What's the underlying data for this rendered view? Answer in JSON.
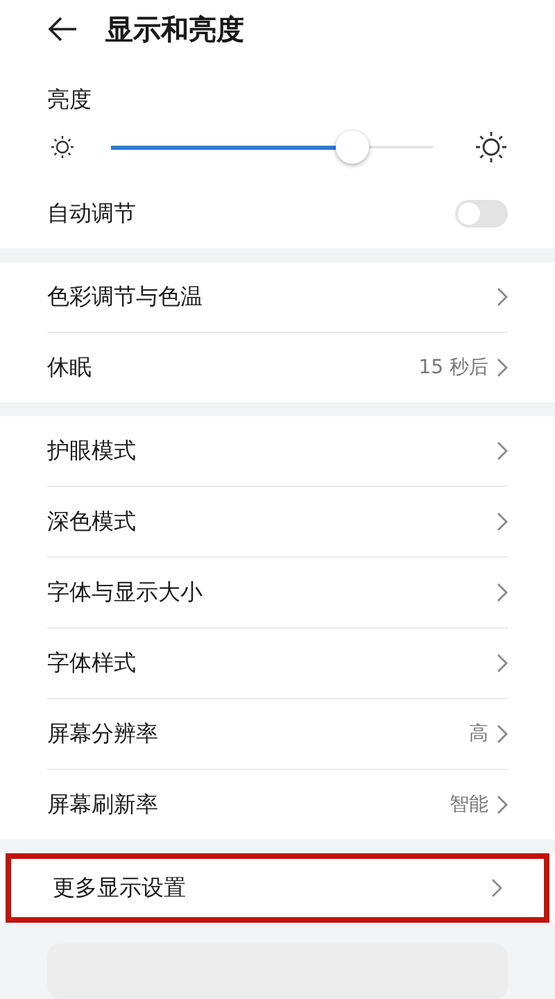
{
  "header": {
    "title": "显示和亮度"
  },
  "brightness": {
    "label": "亮度",
    "level": 0.75,
    "auto_label": "自动调节",
    "auto_on": false
  },
  "groups": [
    {
      "items": [
        {
          "label": "色彩调节与色温",
          "highlighted": false
        },
        {
          "label": "休眠",
          "value": "15 秒后",
          "highlighted": false
        }
      ]
    },
    {
      "items": [
        {
          "label": "护眼模式",
          "highlighted": false
        },
        {
          "label": "深色模式",
          "highlighted": false
        },
        {
          "label": "字体与显示大小",
          "highlighted": false
        },
        {
          "label": "字体样式",
          "highlighted": false
        },
        {
          "label": "屏幕分辨率",
          "value": "高",
          "highlighted": false
        },
        {
          "label": "屏幕刷新率",
          "value": "智能",
          "highlighted": false
        }
      ]
    },
    {
      "items": [
        {
          "label": "更多显示设置",
          "highlighted": true
        }
      ]
    }
  ]
}
